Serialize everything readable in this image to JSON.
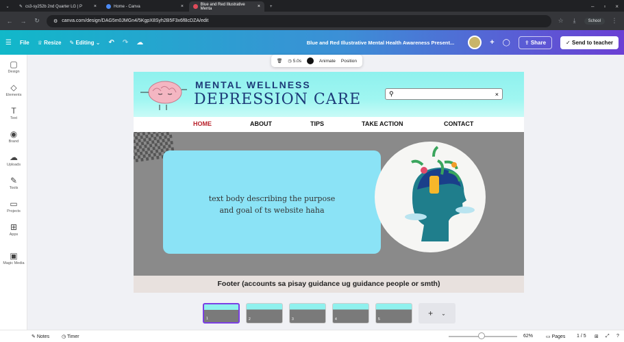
{
  "browser": {
    "tabs": [
      {
        "label": "cs3-sy252b 2nd Quarter LG | P",
        "active": false
      },
      {
        "label": "Home - Canva",
        "active": false
      },
      {
        "label": "Blue and Red Illustrative Menta",
        "active": true
      }
    ],
    "new_tab": "+",
    "url": "canva.com/design/DAG5m0JMGn4/5KgpX8Syh2B5F3x6fBcDZA/edit",
    "profile_label": "School"
  },
  "editor": {
    "menu_icon": "hamburger-icon",
    "file": "File",
    "resize": "Resize",
    "editing": "Editing",
    "title": "Blue and Red Illustrative Mental Health Awareness Present...",
    "share": "Share",
    "send": "Send to teacher"
  },
  "sidebar": {
    "items": [
      {
        "label": "Design",
        "icon": "layout-icon"
      },
      {
        "label": "Elements",
        "icon": "shapes-icon"
      },
      {
        "label": "Text",
        "icon": "text-icon"
      },
      {
        "label": "Brand",
        "icon": "brand-icon"
      },
      {
        "label": "Uploads",
        "icon": "cloud-upload-icon"
      },
      {
        "label": "Tools",
        "icon": "pen-icon"
      },
      {
        "label": "Projects",
        "icon": "folder-icon"
      },
      {
        "label": "Apps",
        "icon": "apps-icon"
      },
      {
        "label": "Magic Media",
        "icon": "magic-media-icon"
      }
    ]
  },
  "toolbar": {
    "duration": "5.0s",
    "animate": "Animate",
    "position": "Position"
  },
  "page": {
    "title_small": "MENTAL WELLNESS",
    "title_big": "DEPRESSION CARE",
    "nav": [
      "HOME",
      "ABOUT",
      "TIPS",
      "TAKE ACTION",
      "CONTACT"
    ],
    "body_line1": "text body describing the purpose",
    "body_line2": "and goal of ts website haha",
    "footer": "Footer (accounts sa pisay guidance ug guidance people or smth)"
  },
  "pages_strip": {
    "thumbs": [
      "1",
      "2",
      "3",
      "4",
      "5"
    ],
    "add": "+",
    "more": "⌄"
  },
  "bottom": {
    "notes": "Notes",
    "timer": "Timer",
    "zoom": "62%",
    "pages": "Pages",
    "page_count": "1 / 5"
  }
}
